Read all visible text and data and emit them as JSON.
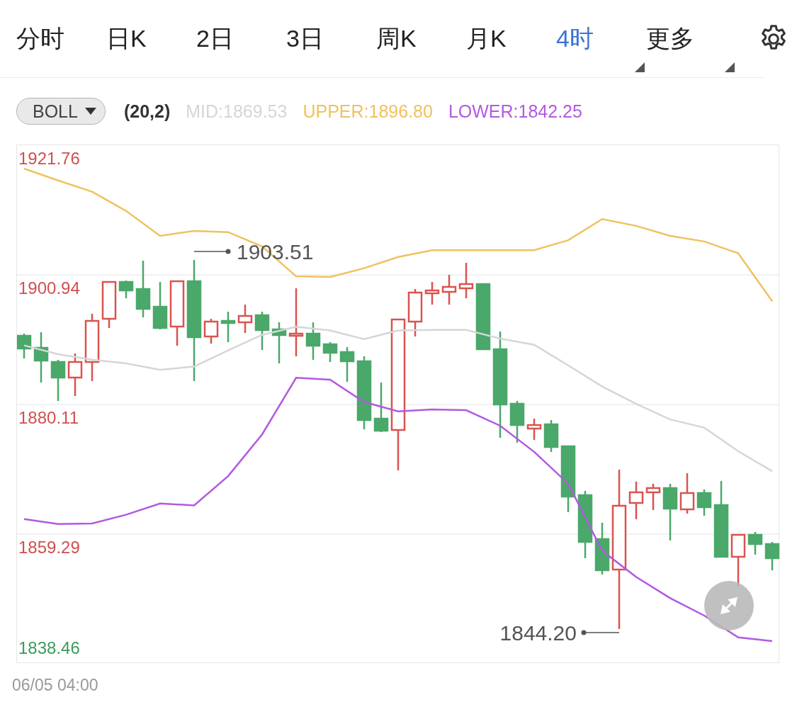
{
  "tabs": [
    {
      "label": "分时",
      "selected": false,
      "dropdown": false
    },
    {
      "label": "日K",
      "selected": false,
      "dropdown": false
    },
    {
      "label": "2日",
      "selected": false,
      "dropdown": false
    },
    {
      "label": "3日",
      "selected": false,
      "dropdown": false
    },
    {
      "label": "周K",
      "selected": false,
      "dropdown": false
    },
    {
      "label": "月K",
      "selected": false,
      "dropdown": false
    },
    {
      "label": "4时",
      "selected": true,
      "dropdown": true
    },
    {
      "label": "更多",
      "selected": false,
      "dropdown": true
    }
  ],
  "indicator": {
    "name": "BOLL",
    "params": "(20,2)",
    "separator": ":",
    "legend": [
      {
        "value": "1869.53"
      },
      {
        "value": "1896.80"
      },
      {
        "value": "1842.25"
      }
    ]
  },
  "chart": {
    "chart_data": {
      "type": "line",
      "categories": [
        null,
        null,
        null,
        null,
        null,
        null,
        null,
        null,
        null,
        null,
        null,
        null,
        null,
        null,
        null,
        null,
        null,
        null,
        null,
        null,
        null,
        null,
        null
      ],
      "grid": true,
      "ylim": [
        1838.46,
        1921.76
      ],
      "yticks": [
        {
          "value": 1921.76,
          "label": "1921.76"
        },
        {
          "value": 1900.94,
          "label": "1900.94"
        },
        {
          "value": 1880.11,
          "label": "1880.11"
        },
        {
          "value": 1859.29,
          "label": "1859.29"
        }
      ],
      "series": [
        {
          "name": "UPPER",
          "color": "#efc25f",
          "values": [
            1918.0,
            1916.1,
            1914.3,
            1911.2,
            1907.2,
            1908.0,
            1907.8,
            1905.5,
            1900.7,
            1900.6,
            1902.0,
            1903.8,
            1904.9,
            1904.9,
            1904.9,
            1904.9,
            1906.5,
            1909.9,
            1908.8,
            1907.2,
            1906.3,
            1904.4,
            1896.7
          ]
        },
        {
          "name": "MID",
          "color": "#d6d6d6",
          "values": [
            1889.6,
            1888.2,
            1887.3,
            1886.7,
            1885.7,
            1886.2,
            1888.8,
            1891.3,
            1892.6,
            1892.0,
            1890.6,
            1892.0,
            1892.1,
            1892.1,
            1890.7,
            1889.7,
            1886.4,
            1883.0,
            1880.2,
            1877.7,
            1876.4,
            1872.6,
            1869.4
          ]
        },
        {
          "name": "LOWER",
          "color": "#b259e0",
          "values": [
            1861.7,
            1860.9,
            1861.0,
            1862.4,
            1864.2,
            1863.9,
            1868.6,
            1875.3,
            1884.4,
            1884.1,
            1880.5,
            1879.0,
            1879.3,
            1879.2,
            1876.7,
            1872.5,
            1867.4,
            1856.6,
            1852.4,
            1849.0,
            1846.2,
            1842.7,
            1842.1
          ]
        }
      ],
      "annotations": [
        {
          "text": "1903.51"
        },
        {
          "text": "1844.20"
        }
      ]
    },
    "bottom_label": "1838.46",
    "time_label": "06/05 04:00"
  }
}
